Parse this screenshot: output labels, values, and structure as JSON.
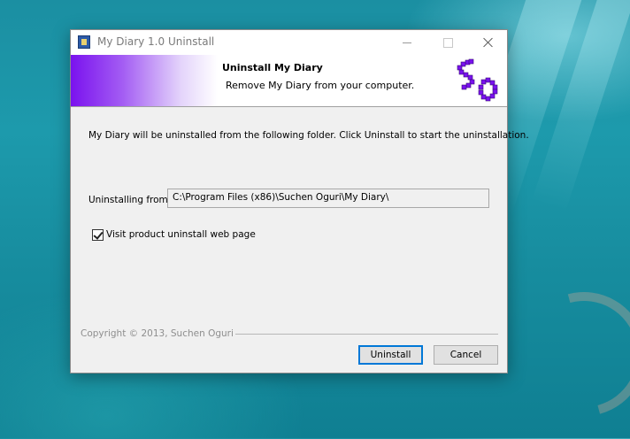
{
  "window": {
    "title": "My Diary 1.0 Uninstall",
    "icon": "app-icon",
    "controls": [
      "minimize-icon",
      "maximize-icon",
      "close-icon"
    ]
  },
  "header": {
    "title": "Uninstall My Diary",
    "subtitle": "Remove My Diary from your computer.",
    "logo_text": "SO"
  },
  "body": {
    "description": "My Diary will be uninstalled from the following folder. Click Uninstall to start the uninstallation.",
    "uninstalling_from_label": "Uninstalling from:",
    "uninstalling_from_value": "C:\\Program Files (x86)\\Suchen Oguri\\My Diary\\",
    "checkbox_label": "Visit product uninstall web page",
    "checkbox_checked": true
  },
  "footer": {
    "copyright": "Copyright © 2013, Suchen Oguri",
    "uninstall_label": "Uninstall",
    "cancel_label": "Cancel"
  },
  "colors": {
    "accent_purple": "#7a12ee",
    "focus_blue": "#0078d7"
  }
}
